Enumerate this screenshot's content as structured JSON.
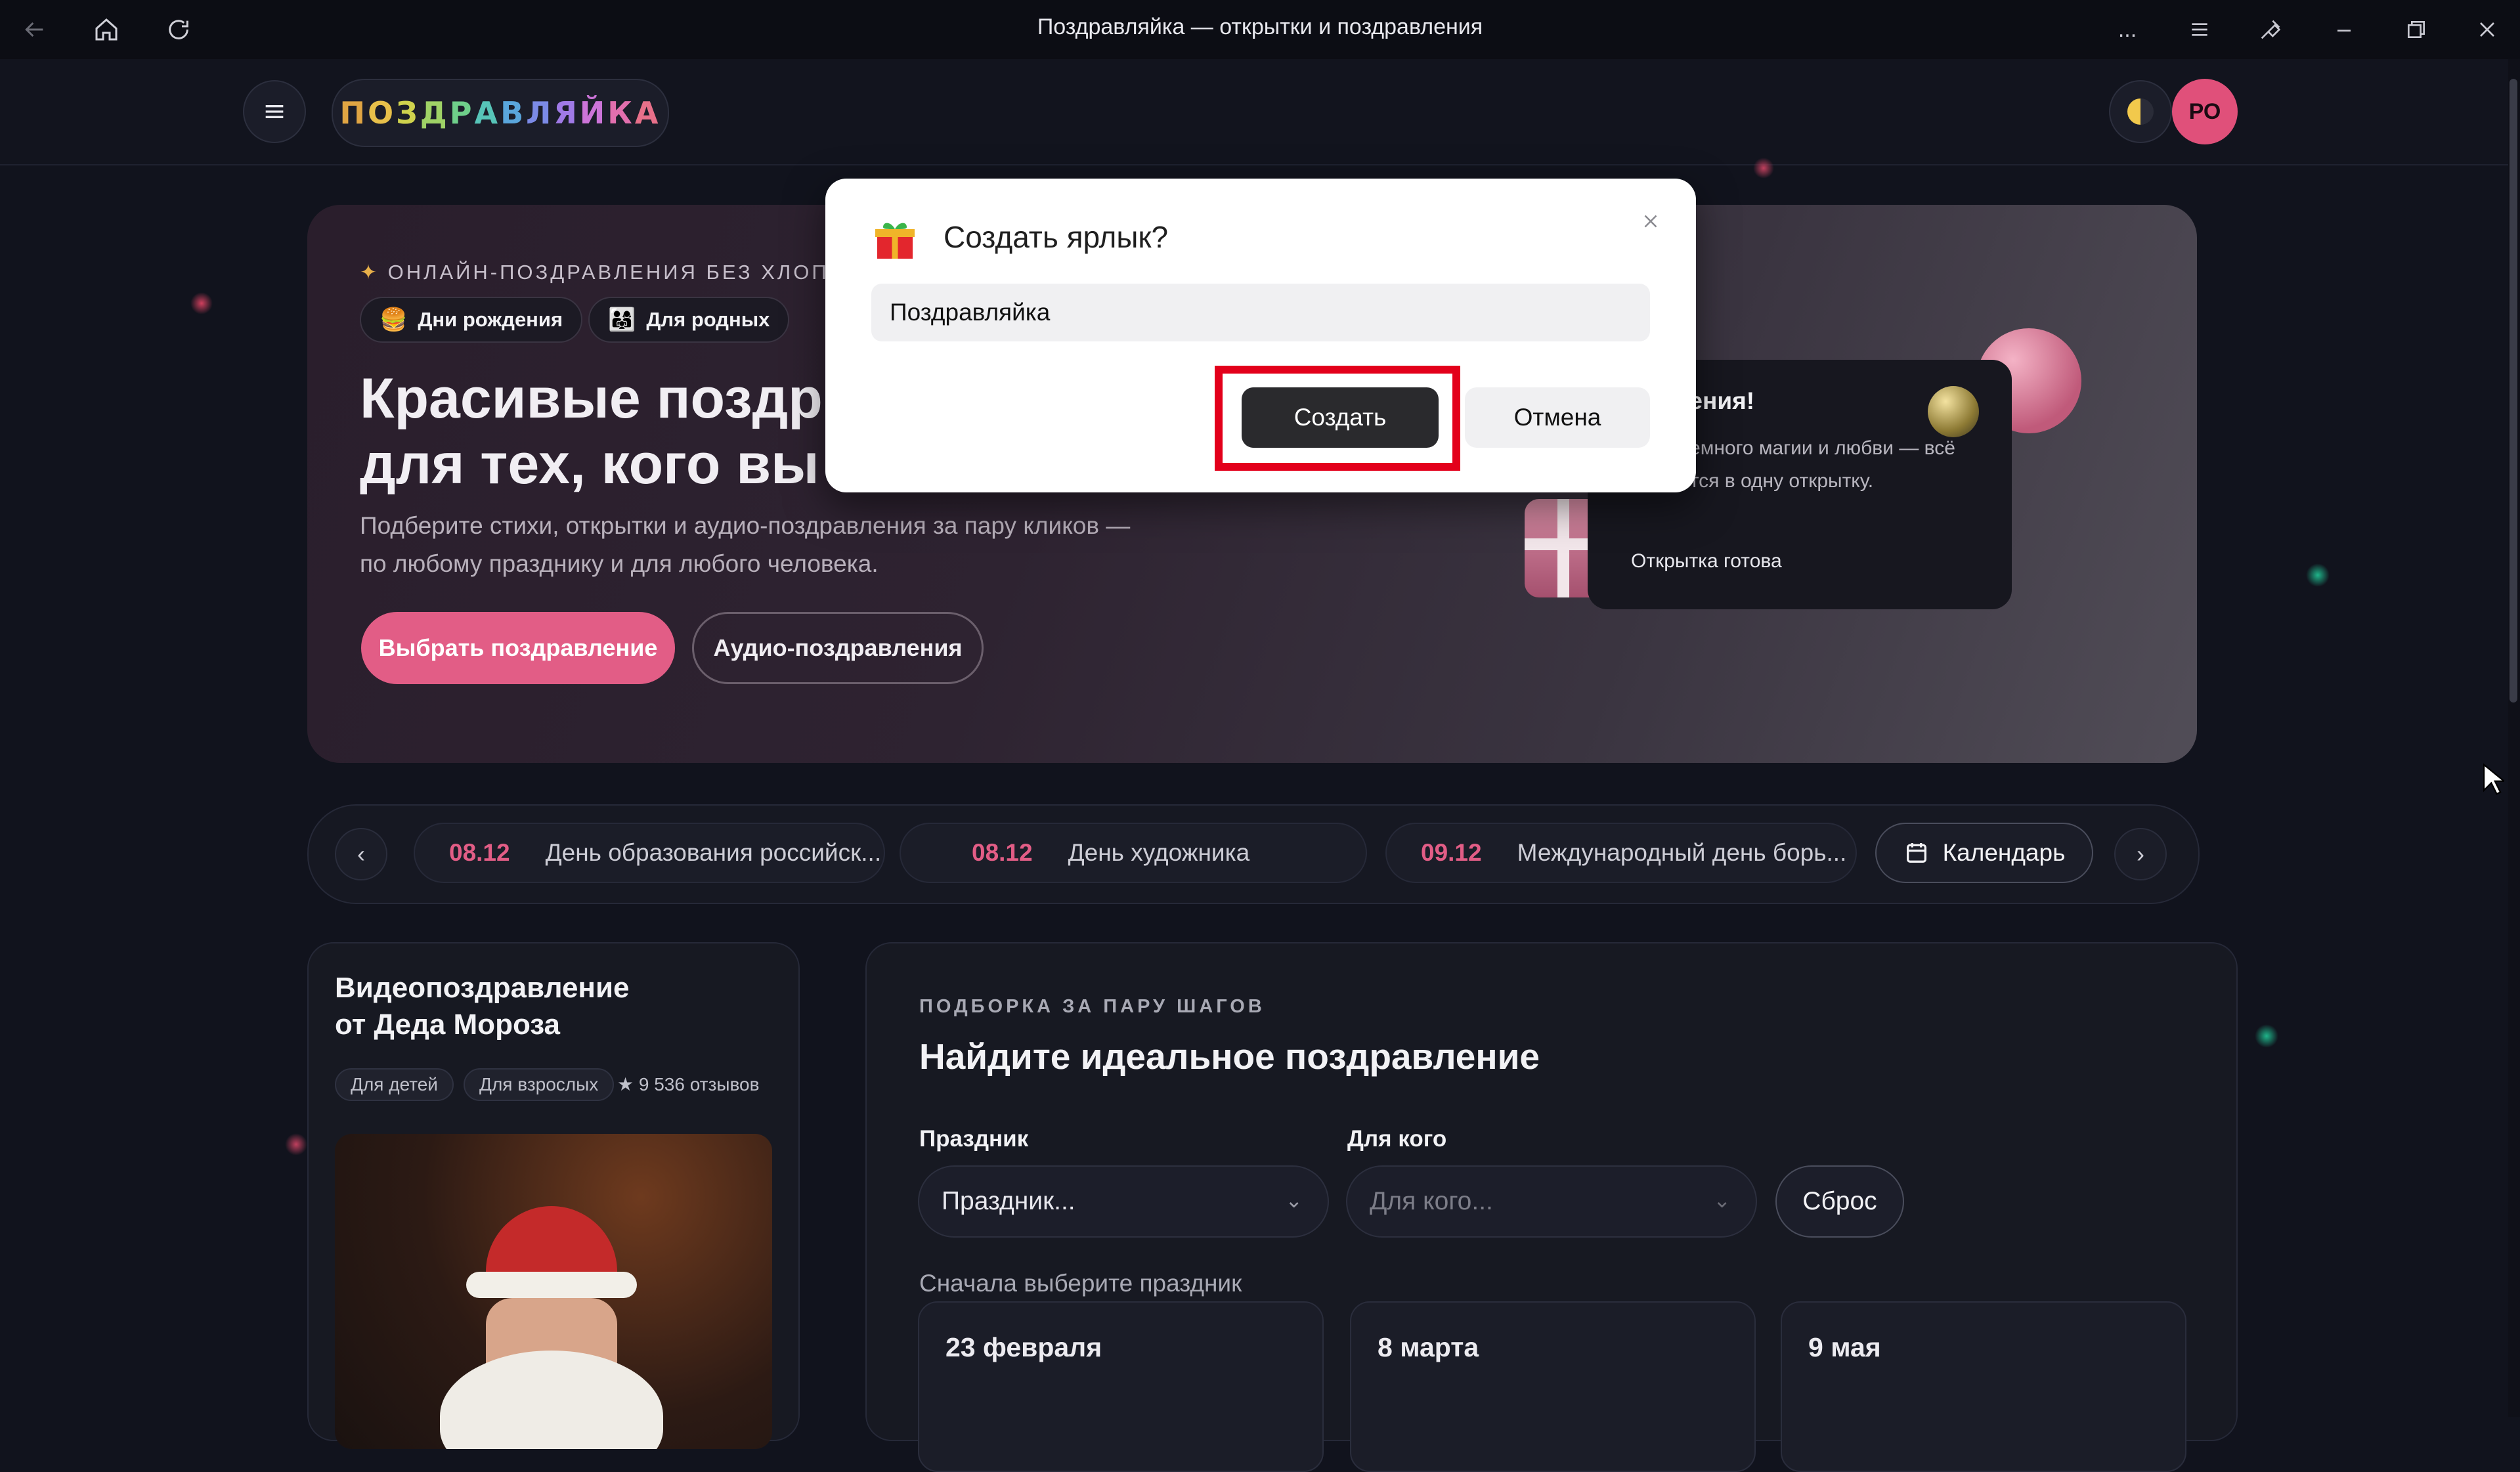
{
  "window": {
    "title": "Поздравляйка — открытки и поздравления",
    "more_label": "..."
  },
  "header": {
    "logo_text": "ПОЗДРАВЛЯЙКА",
    "avatar_initials": "РО"
  },
  "hero": {
    "kicker": "ОНЛАЙН-ПОЗДРАВЛЕНИЯ БЕЗ ХЛОПОТ",
    "chips": [
      {
        "icon": "🍔",
        "label": "Дни рождения"
      },
      {
        "icon": "👨‍👩‍👧",
        "label": "Для родных"
      }
    ],
    "title_line1": "Красивые поздр",
    "title_line2": "для тех, кого вы",
    "subtitle": "Подберите стихи, открытки и аудио-поздравления за пару кликов — по любому празднику и для любого человека.",
    "primary_button": "Выбрать поздравление",
    "secondary_button": "Аудио-поздравления",
    "card": {
      "title": "рождения!",
      "text": "слова, немного магии и любви — всё поместится в одну открытку.",
      "status": "Открытка готова"
    }
  },
  "date_strip": {
    "items": [
      {
        "date": "08.12",
        "name": "День образования российск..."
      },
      {
        "date": "08.12",
        "name": "День художника"
      },
      {
        "date": "09.12",
        "name": "Международный день борь..."
      }
    ],
    "calendar_button": "Календарь",
    "prev_glyph": "‹",
    "next_glyph": "›"
  },
  "video_card": {
    "title_line1": "Видеопоздравление",
    "title_line2": "от Деда Мороза",
    "tags": [
      "Для детей",
      "Для взрослых"
    ],
    "reviews": "★ 9 536 отзывов"
  },
  "selector": {
    "kicker": "ПОДБОРКА ЗА ПАРУ ШАГОВ",
    "title": "Найдите идеальное поздравление",
    "holiday_label": "Праздник",
    "holiday_placeholder": "Праздник...",
    "recipient_label": "Для кого",
    "recipient_placeholder": "Для кого...",
    "reset_button": "Сброс",
    "hint": "Сначала выберите праздник",
    "holidays": [
      "23 февраля",
      "8 марта",
      "9 мая"
    ]
  },
  "dialog": {
    "title": "Создать ярлык?",
    "input_value": "Поздравляйка",
    "create_button": "Создать",
    "cancel_button": "Отмена",
    "highlight_color": "#e3001b"
  },
  "colors": {
    "accent_pink": "#e25d86",
    "background": "#11131d",
    "avatar": "#e0507a"
  }
}
